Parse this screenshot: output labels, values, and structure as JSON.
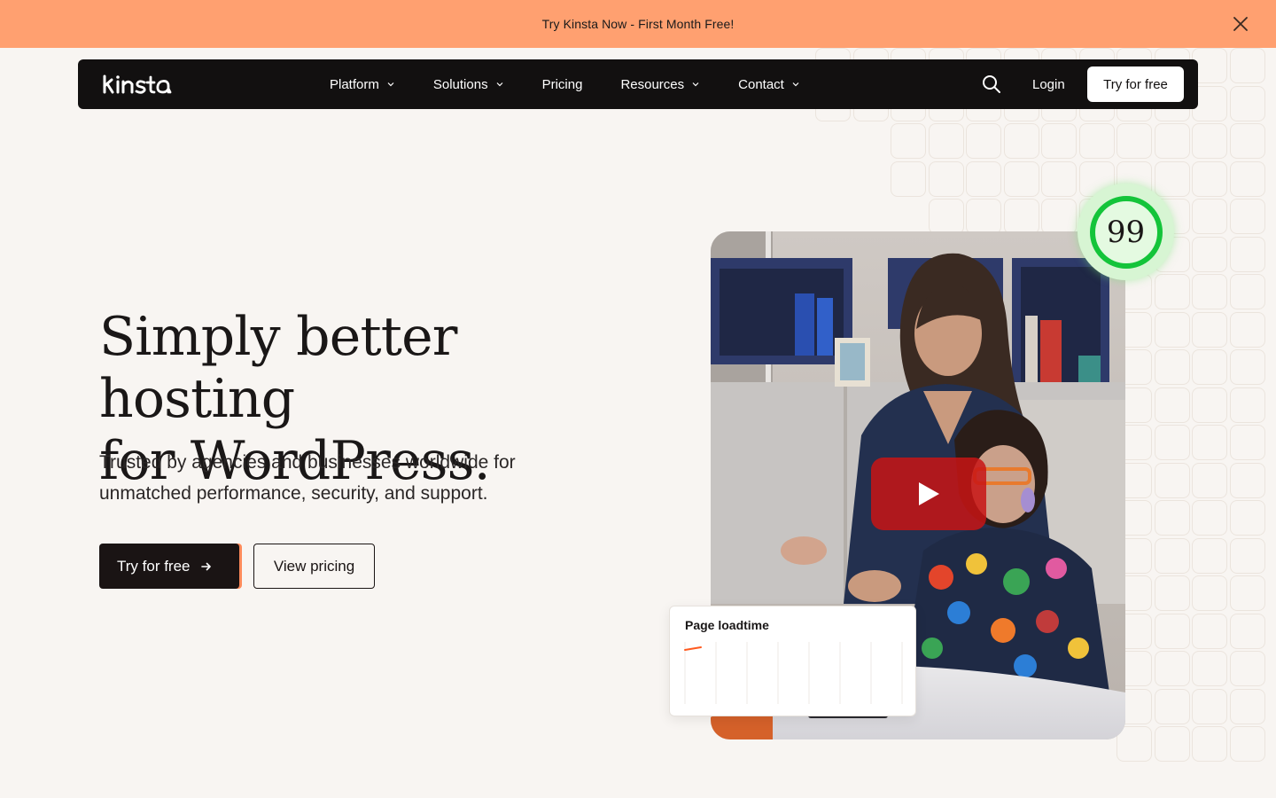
{
  "promo": {
    "text": "Try Kinsta Now - First Month Free!",
    "close_icon": "close-icon"
  },
  "nav": {
    "logo": "kinsta",
    "items": [
      {
        "label": "Platform",
        "dropdown": true
      },
      {
        "label": "Solutions",
        "dropdown": true
      },
      {
        "label": "Pricing",
        "dropdown": false
      },
      {
        "label": "Resources",
        "dropdown": true
      },
      {
        "label": "Contact",
        "dropdown": true
      }
    ],
    "search_icon": "search-icon",
    "login_label": "Login",
    "cta_label": "Try for free"
  },
  "hero": {
    "title_line1": "Simply better hosting",
    "title_line2": "for WordPress.",
    "subtitle_line1": "Trusted by agencies and businesses worldwide for",
    "subtitle_line2": "unmatched performance, security, and support.",
    "primary_cta": "Try for free",
    "secondary_cta": "View pricing"
  },
  "media": {
    "play_icon": "play-icon"
  },
  "score": {
    "value": "99"
  },
  "loadtime": {
    "title": "Page loadtime"
  },
  "colors": {
    "promo_bg": "#ffa070",
    "nav_bg": "#121010",
    "page_bg": "#f8f5f2",
    "score_ring": "#14c43a",
    "accent": "#ff8a5a"
  }
}
